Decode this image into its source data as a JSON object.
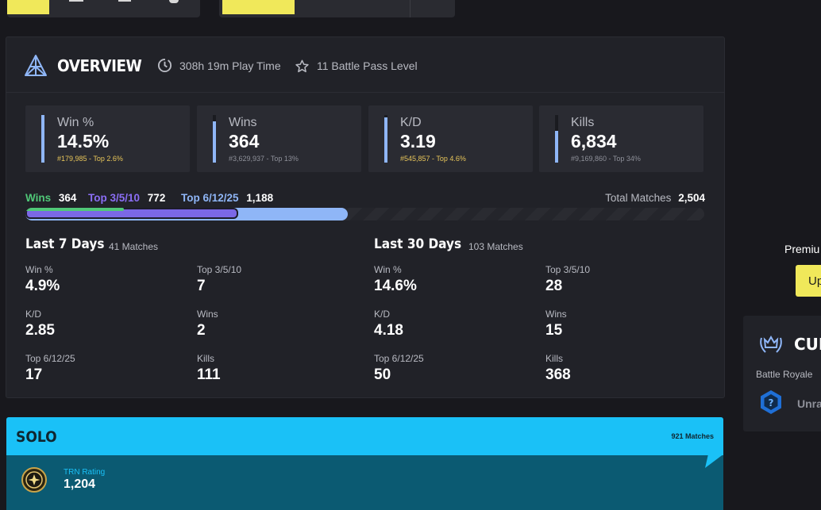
{
  "overview": {
    "title": "OVERVIEW",
    "play_time": "308h 19m Play Time",
    "battle_pass": "11 Battle Pass Level",
    "stats": [
      {
        "label": "Win %",
        "value": "14.5%",
        "sub": "#179,985 - Top 2.6%",
        "sub_color": "gold",
        "fill": 1.0
      },
      {
        "label": "Wins",
        "value": "364",
        "sub": "#3,629,937 - Top 13%",
        "sub_color": "gray",
        "fill": 0.87
      },
      {
        "label": "K/D",
        "value": "3.19",
        "sub": "#545,857 - Top 4.6%",
        "sub_color": "gold",
        "fill": 0.95
      },
      {
        "label": "Kills",
        "value": "6,834",
        "sub": "#9,169,860 - Top 34%",
        "sub_color": "gray",
        "fill": 0.66
      }
    ],
    "legend": {
      "wins_label": "Wins",
      "wins_value": "364",
      "top3_label": "Top 3/5/10",
      "top3_value": "772",
      "top6_label": "Top 6/12/25",
      "top6_value": "1,188",
      "total_label": "Total Matches",
      "total_value": "2,504"
    },
    "colors": {
      "wins": "#50c878",
      "top3": "#7b68e6",
      "top6": "#8fb6f7"
    },
    "last7": {
      "title": "Last 7 Days",
      "matches": "41 Matches",
      "stats": [
        {
          "label": "Win %",
          "value": "4.9%"
        },
        {
          "label": "Top 3/5/10",
          "value": "7"
        },
        {
          "label": "K/D",
          "value": "2.85"
        },
        {
          "label": "Wins",
          "value": "2"
        },
        {
          "label": "Top 6/12/25",
          "value": "17"
        },
        {
          "label": "Kills",
          "value": "111"
        }
      ]
    },
    "last30": {
      "title": "Last 30 Days",
      "matches": "103 Matches",
      "stats": [
        {
          "label": "Win %",
          "value": "14.6%"
        },
        {
          "label": "Top 3/5/10",
          "value": "28"
        },
        {
          "label": "K/D",
          "value": "4.18"
        },
        {
          "label": "Wins",
          "value": "15"
        },
        {
          "label": "Top 6/12/25",
          "value": "50"
        },
        {
          "label": "Kills",
          "value": "368"
        }
      ]
    }
  },
  "solo": {
    "title": "SOLO",
    "matches": "921 Matches",
    "trn_label": "TRN Rating",
    "trn_value": "1,204"
  },
  "sidebar": {
    "premium_text": "Premiu",
    "upgrade_label": "Up",
    "card_title": "CUR",
    "card_sub": "Battle Royale",
    "rank_text": "Unra"
  }
}
